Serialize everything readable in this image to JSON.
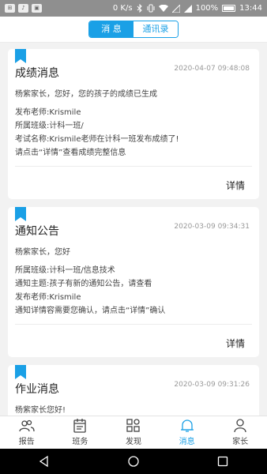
{
  "status_bar": {
    "apps": [
      "⊞",
      "♪",
      "▣"
    ],
    "net_speed": "0 K/s",
    "battery": "100%",
    "time": "13:44"
  },
  "header": {
    "tabs": [
      {
        "label": "消 息",
        "active": true
      },
      {
        "label": "通讯录",
        "active": false
      }
    ]
  },
  "cards": [
    {
      "title": "成绩消息",
      "time": "2020-04-07 09:48:08",
      "greeting": "杨紫家长，您好，您的孩子的成绩已生成",
      "lines": [
        "发布老师:Krismile",
        "所属班级:计科一班/",
        "考试名称:Krismile老师在计科一班发布成绩了!",
        "请点击“详情”查看成绩完整信息"
      ],
      "detail": "详情"
    },
    {
      "title": "通知公告",
      "time": "2020-03-09 09:34:31",
      "greeting": "杨紫家长，您好",
      "lines": [
        "所属班级:计科一班/信息技术",
        "通知主题:孩子有新的通知公告，请查看",
        "发布老师:Krismile",
        "通知详情容需要您确认，请点击“详情”确认"
      ],
      "detail": "详情"
    },
    {
      "title": "作业消息",
      "time": "2020-03-09 09:31:26",
      "greeting": "杨紫家长您好!"
    }
  ],
  "tabbar": [
    {
      "label": "报告",
      "icon": "people-icon",
      "active": false
    },
    {
      "label": "班务",
      "icon": "calendar-icon",
      "active": false
    },
    {
      "label": "发现",
      "icon": "grid-icon",
      "active": false
    },
    {
      "label": "消息",
      "icon": "bell-icon",
      "active": true
    },
    {
      "label": "家长",
      "icon": "person-icon",
      "active": false
    }
  ],
  "colors": {
    "accent": "#1aa0e6",
    "background": "#f2f2f2",
    "status_bar": "#8f8f8f"
  }
}
